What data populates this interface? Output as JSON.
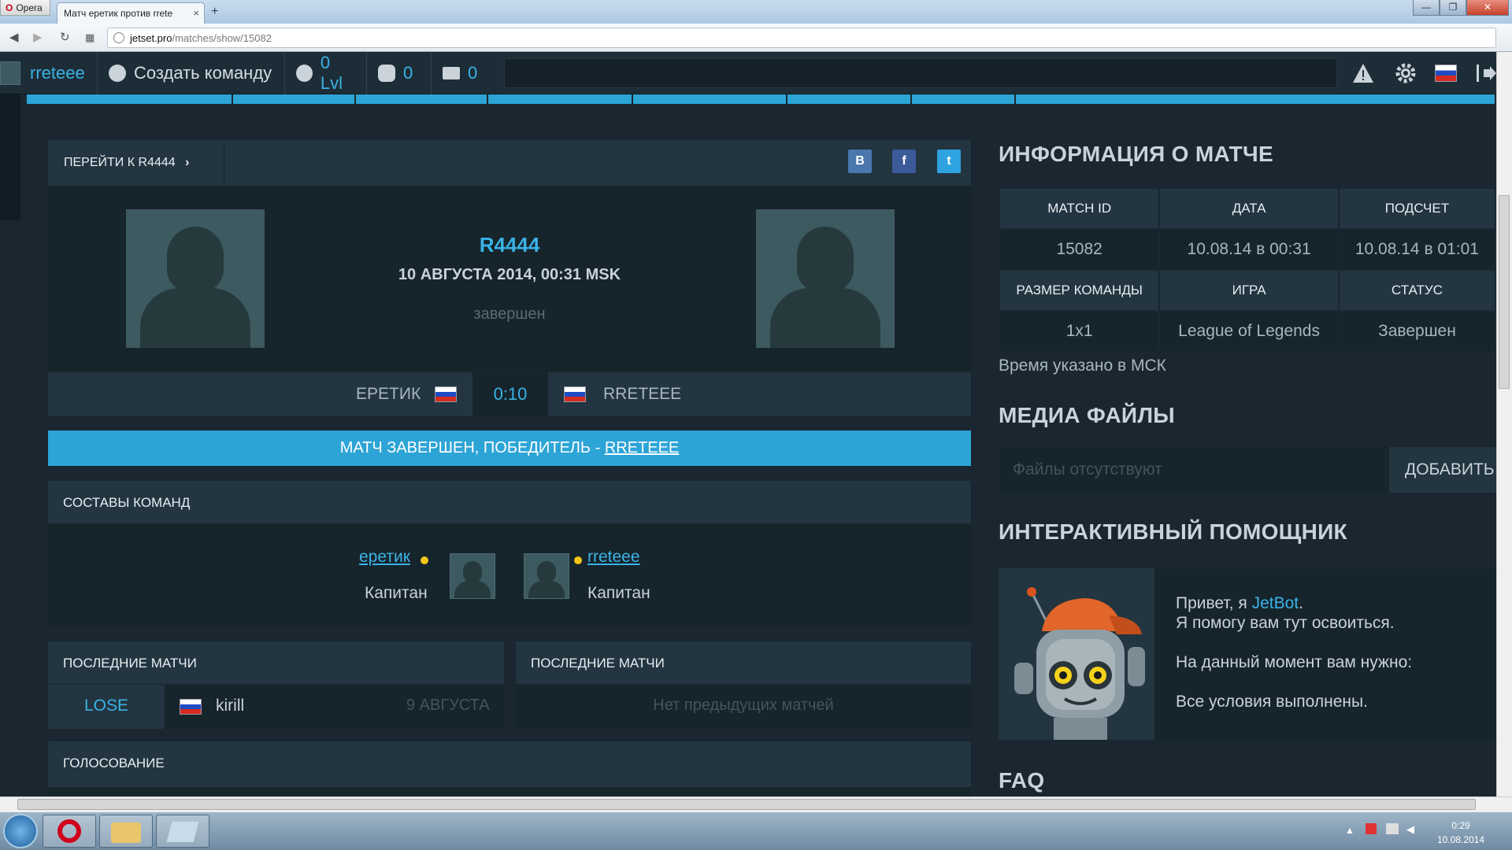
{
  "browser": {
    "menu_label": "Opera",
    "tab_title": "Матч еретик против rrete",
    "tab_close": "×",
    "new_tab": "+",
    "url_host": "jetset.pro",
    "url_path": "/matches/show/15082",
    "win_min": "—",
    "win_max": "❐",
    "win_close": "✕"
  },
  "header": {
    "username": "rreteee",
    "create_team": "Создать команду",
    "level": "0 Lvl",
    "money": "0",
    "messages": "0"
  },
  "match": {
    "goto_label": "ПЕРЕЙТИ К R4444",
    "social": {
      "vk": "В",
      "fb": "f",
      "tw": "t"
    },
    "name": "R4444",
    "date": "10 АВГУСТА 2014, 00:31 MSK",
    "status": "завершен",
    "team_left": "ЕРЕТИК",
    "team_right": "RRETEEE",
    "score": "0:10",
    "winner_prefix": "МАТЧ ЗАВЕРШЕН, ПОБЕДИТЕЛЬ - ",
    "winner_name": "RRETEEE"
  },
  "roster": {
    "title": "СОСТАВЫ КОМАНД",
    "left": {
      "name": "еретик",
      "role": "Капитан"
    },
    "right": {
      "name": "rreteee",
      "role": "Капитан"
    }
  },
  "last_matches": {
    "left_title": "ПОСЛЕДНИЕ МАТЧИ",
    "right_title": "ПОСЛЕДНИЕ МАТЧИ",
    "left_row": {
      "result": "LOSE",
      "opponent": "kirill",
      "date": "9 АВГУСТА"
    },
    "right_empty": "Нет предыдущих матчей"
  },
  "voting": {
    "title": "ГОЛОСОВАНИЕ"
  },
  "info": {
    "title": "ИНФОРМАЦИЯ О МАТЧЕ",
    "h1": "MATCH ID",
    "h2": "ДАТА",
    "h3": "ПОДСЧЕТ",
    "v1": "15082",
    "v2": "10.08.14 в 00:31",
    "v3": "10.08.14 в 01:01",
    "h4": "РАЗМЕР КОМАНДЫ",
    "h5": "ИГРА",
    "h6": "СТАТУС",
    "v4": "1x1",
    "v5": "League of Legends",
    "v6": "Завершен",
    "tz_note": "Время указано в МСК"
  },
  "media": {
    "title": "МЕДИА ФАЙЛЫ",
    "placeholder": "Файлы отсутствуют",
    "add_label": "ДОБАВИТЬ"
  },
  "assistant": {
    "title": "ИНТЕРАКТИВНЫЙ ПОМОЩНИК",
    "greet_prefix": "Привет, я ",
    "bot_name": "JetBot",
    "greet_suffix": ".",
    "line2": "Я помогу вам тут освоиться.",
    "line3": "На данный момент вам нужно:",
    "line4": "Все условия выполнены."
  },
  "faq": {
    "title": "FAQ"
  },
  "taskbar": {
    "time": "0:29",
    "date": "10.08.2014"
  },
  "colors": {
    "accent": "#2da4d6",
    "bg": "#1a2730",
    "panel": "#223540",
    "link": "#3ab3e6"
  }
}
